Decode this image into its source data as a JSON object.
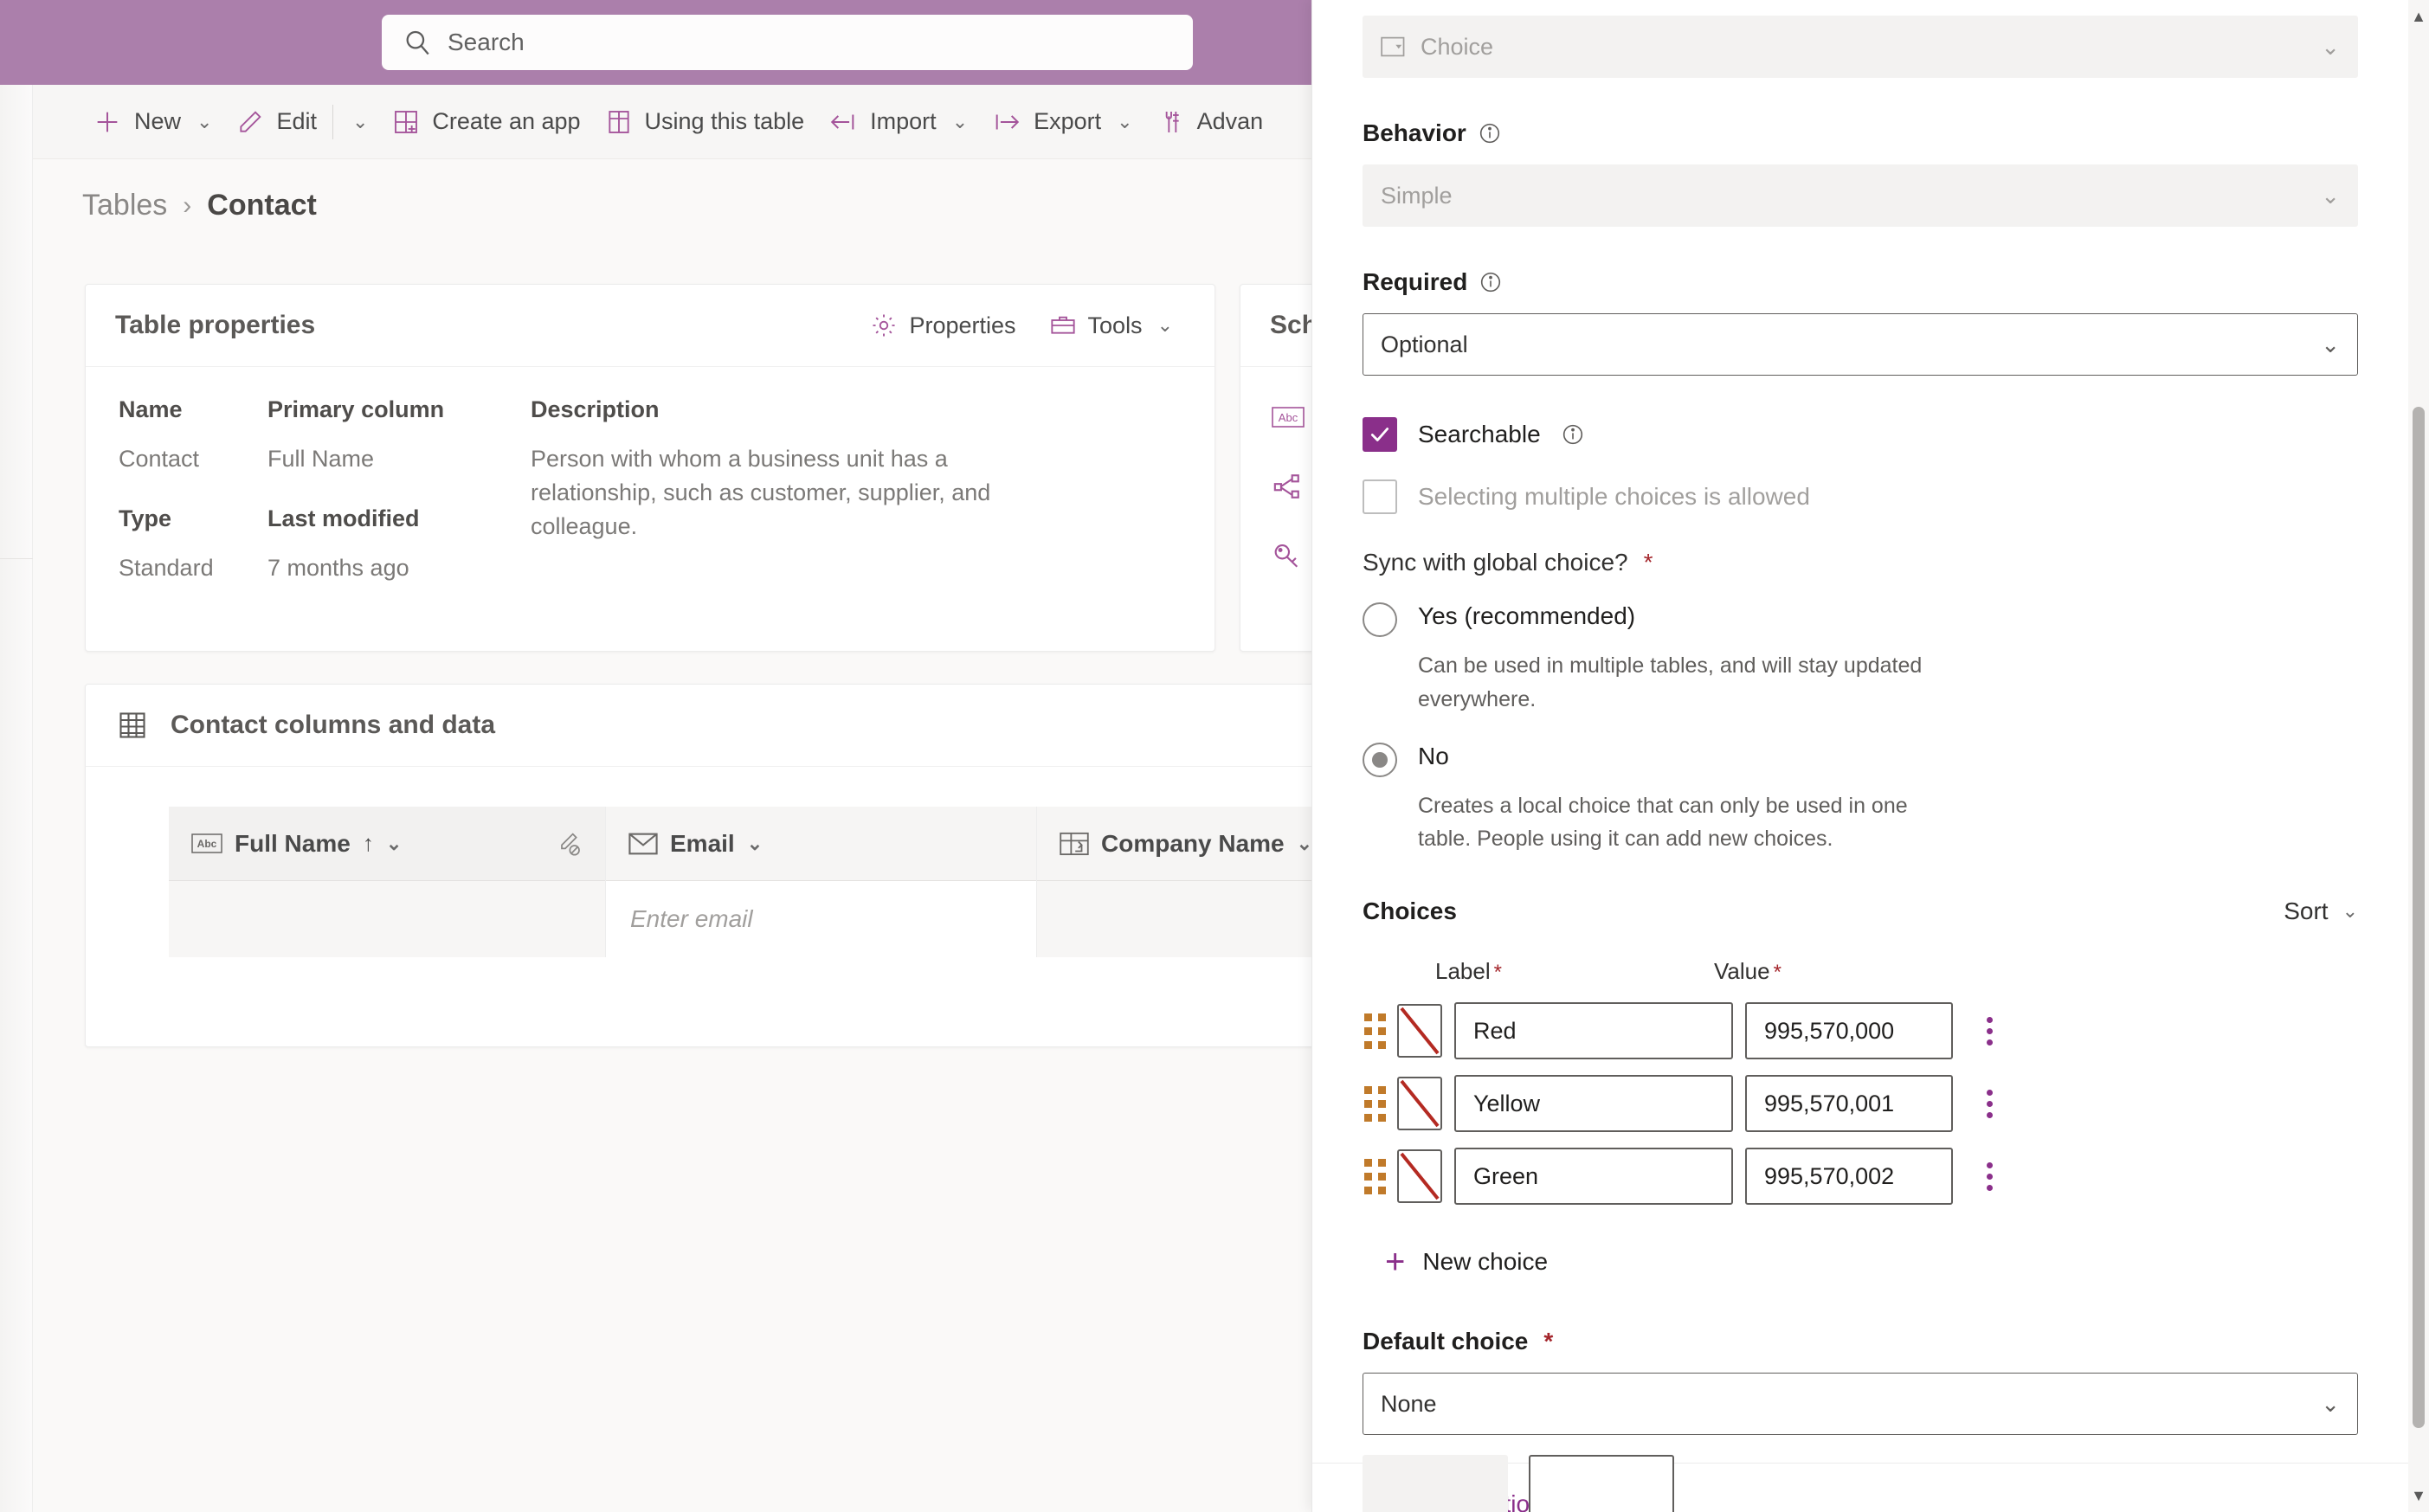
{
  "topbar": {
    "search_placeholder": "Search",
    "search_icon": "search-icon",
    "bg_color": "#ab7fab"
  },
  "commandbar": {
    "items": [
      {
        "label": "New",
        "icon": "plus-icon",
        "has_chevron": true
      },
      {
        "label": "Edit",
        "icon": "pencil-icon",
        "has_chevron": true
      },
      {
        "label": "Create an app",
        "icon": "app-grid-icon",
        "has_chevron": false
      },
      {
        "label": "Using this table",
        "icon": "table-layout-icon",
        "has_chevron": false
      },
      {
        "label": "Import",
        "icon": "import-arrow-icon",
        "has_chevron": true
      },
      {
        "label": "Export",
        "icon": "export-arrow-icon",
        "has_chevron": true
      },
      {
        "label": "Advan",
        "icon": "advanced-tools-icon",
        "has_chevron": false
      }
    ]
  },
  "breadcrumb": {
    "parent": "Tables",
    "separator": "›",
    "current": "Contact"
  },
  "table_properties": {
    "title": "Table properties",
    "actions": [
      {
        "label": "Properties",
        "icon": "gear-icon",
        "has_chevron": false
      },
      {
        "label": "Tools",
        "icon": "toolbox-icon",
        "has_chevron": true
      }
    ],
    "fields": [
      {
        "label": "Name",
        "value": "Contact"
      },
      {
        "label": "Type",
        "value": "Standard"
      },
      {
        "label": "Primary column",
        "value": "Full Name"
      },
      {
        "label": "Last modified",
        "value": "7 months ago"
      },
      {
        "label": "Description",
        "value": "Person with whom a business unit has a relationship, such as customer, supplier, and colleague."
      }
    ]
  },
  "schema_card": {
    "title": "Sche",
    "rows": [
      {
        "icon": "abc-columns-icon"
      },
      {
        "icon": "relationships-icon"
      },
      {
        "icon": "key-icon"
      }
    ]
  },
  "columns_card": {
    "title": "Contact columns and data",
    "icon": "table-grid-icon",
    "columns": [
      {
        "label": "Full Name",
        "icon": "abc-text-icon",
        "sorted": "↑",
        "has_chevron": true,
        "has_edit_lock": true
      },
      {
        "label": "Email",
        "icon": "envelope-icon",
        "has_chevron": true
      },
      {
        "label": "Company Name",
        "icon": "lookup-icon",
        "has_chevron": true
      }
    ],
    "rows": [
      {
        "full_name": "",
        "email": "Enter email",
        "company_name": ""
      }
    ]
  },
  "panel": {
    "data_type": {
      "value": "Choice",
      "icon": "choice-icon",
      "disabled": true
    },
    "behavior": {
      "label": "Behavior",
      "info_icon": "info-icon",
      "value": "Simple",
      "disabled": true
    },
    "required": {
      "label": "Required",
      "info_icon": "info-icon",
      "value": "Optional",
      "disabled": false
    },
    "searchable": {
      "label": "Searchable",
      "checked": true,
      "info_icon": "info-icon",
      "accent_color": "#8a2f8a"
    },
    "multi_select": {
      "label": "Selecting multiple choices is allowed",
      "checked": false,
      "disabled": true
    },
    "sync_global": {
      "label": "Sync with global choice?",
      "required_mark": "*",
      "options": [
        {
          "label": "Yes (recommended)",
          "selected": false,
          "help": "Can be used in multiple tables, and will stay updated everywhere."
        },
        {
          "label": "No",
          "selected": true,
          "help": "Creates a local choice that can only be used in one table. People using it can add new choices."
        }
      ]
    },
    "choices": {
      "title": "Choices",
      "sort_label": "Sort",
      "col_label": "Label",
      "col_value": "Value",
      "required_mark": "*",
      "rows": [
        {
          "label": "Red",
          "value": "995,570,000",
          "swatch": "no-color-icon"
        },
        {
          "label": "Yellow",
          "value": "995,570,001",
          "swatch": "no-color-icon"
        },
        {
          "label": "Green",
          "value": "995,570,002",
          "swatch": "no-color-icon"
        }
      ],
      "new_choice_label": "New choice"
    },
    "default_choice": {
      "label": "Default choice",
      "required_mark": "*",
      "value": "None"
    },
    "advanced_options": {
      "label": "Advanced options"
    }
  },
  "colors": {
    "brand_purple": "#ab7fab",
    "accent_magenta": "#8a2f8a",
    "icon_purple": "#a4549a",
    "required_red": "#a4262c",
    "text_dark": "#201f1e",
    "text_mid": "#605e5c",
    "text_dim": "#a19f9d"
  }
}
